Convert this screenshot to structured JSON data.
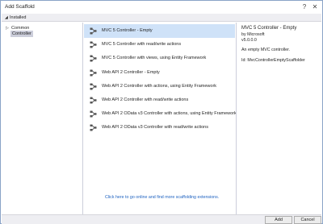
{
  "window": {
    "title": "Add Scaffold",
    "help_glyph": "?",
    "close_glyph": "✕"
  },
  "header": {
    "arrow": "◢",
    "label": "Installed"
  },
  "tree": {
    "expander": "▷",
    "common": "Common",
    "controller": "Controller"
  },
  "items": [
    {
      "label": "MVC 5 Controller - Empty"
    },
    {
      "label": "MVC 5 Controller with read/write actions"
    },
    {
      "label": "MVC 5 Controller with views, using Entity Framework"
    },
    {
      "label": "Web API 2 Controller - Empty"
    },
    {
      "label": "Web API 2 Controller with actions, using Entity Framework"
    },
    {
      "label": "Web API 2 Controller with read/write actions"
    },
    {
      "label": "Web API 2 OData v3 Controller with actions, using Entity Framework"
    },
    {
      "label": "Web API 2 OData v3 Controller with read/write actions"
    }
  ],
  "selected_index": 0,
  "online_link": "Click here to go online and find more scaffolding extensions.",
  "details": {
    "title": "MVC 5 Controller - Empty",
    "by": "by Microsoft",
    "version": "v5.0.0.0",
    "description": "An empty MVC controller.",
    "id": "Id: MvcControllerEmptyScaffolder"
  },
  "footer": {
    "add": "Add",
    "cancel": "Cancel"
  },
  "colors": {
    "selection": "#cfe2f8",
    "link": "#1e62c0",
    "header_bg": "#eeeef2",
    "icon": "#555555"
  }
}
